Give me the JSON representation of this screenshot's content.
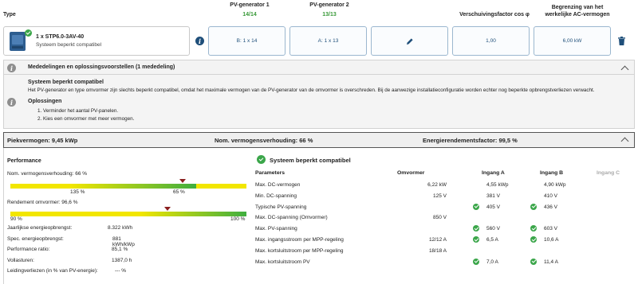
{
  "header": {
    "type_label": "Type",
    "pv1_label": "PV-generator 1",
    "pv1_count": "14/14",
    "pv2_label": "PV-generator 2",
    "pv2_count": "13/13",
    "cos_label": "Verschuivingsfactor cos φ",
    "limit_label_1": "Begrenzing van het",
    "limit_label_2": "werkelijke AC-vermogen"
  },
  "inverter": {
    "name": "1 x STP6.0-3AV-40",
    "status": "Systeem beperkt compatibel",
    "pv1_value": "B: 1 x 14",
    "pv2_value": "A: 1 x 13",
    "cos_value": "1,00",
    "limit_value": "6,00 kW"
  },
  "notices": {
    "header": "Mededelingen en oplossingsvoorstellen (1 mededeling)",
    "title": "Systeem beperkt compatibel",
    "text": "Het PV-generator en type omvormer zijn slechts beperkt compatibel, omdat het maximale vermogen van de PV-generator van de omvormer is overschreden. Bij de aanwezige installatieconfiguratie worden echter nog beperkte opbrengstverliezen verwacht.",
    "solutions_title": "Oplossingen",
    "solutions": [
      "1. Verminder het aantal PV-panelen.",
      "2. Kies een omvormer met meer vermogen."
    ]
  },
  "summary": {
    "peak": "Piekvermogen: 9,45 kWp",
    "ratio": "Nom. vermogensverhouding: 66 %",
    "efficiency": "Energierendementsfactor: 99,5 %"
  },
  "performance": {
    "title": "Performance",
    "ratio_label": "Nom. vermogensverhouding: 66 %",
    "ratio_value": 0.66,
    "ratio_tick_left": "135 %",
    "ratio_tick_right": "65 %",
    "eff_label": "Rendement omvormer: 96,6 %",
    "eff_value": 0.966,
    "eff_tick_left": "90 %",
    "eff_tick_right": "100 %",
    "stats": [
      {
        "label": "Jaarlijkse energieopbrengst:",
        "value": "8.322 kWh"
      },
      {
        "label": "Spec. energieopbrengst:",
        "value": "881 kWh/kWp"
      },
      {
        "label": "Performance ratio:",
        "value": "85,1 %"
      },
      {
        "label": "Vollasturen:",
        "value": "1387,0 h"
      },
      {
        "label": "Leidingverliezen (in % van PV-energie):",
        "value": "--- %"
      }
    ]
  },
  "compat": {
    "title": "Systeem beperkt compatibel",
    "columns": [
      "Parameters",
      "Omvormer",
      "Ingang A",
      "Ingang B",
      "Ingang C"
    ],
    "rows": [
      {
        "param": "Max. DC-vermogen",
        "inv": "6,22 kW",
        "a": "4,55 kWp",
        "b": "4,90 kWp",
        "ca": false,
        "cb": false
      },
      {
        "param": "Min. DC-spanning",
        "inv": "125 V",
        "a": "381 V",
        "b": "410 V",
        "ca": false,
        "cb": false
      },
      {
        "param": "Typische PV-spanning",
        "inv": "",
        "a": "405 V",
        "b": "436 V",
        "ca": true,
        "cb": true
      },
      {
        "param": "Max. DC-spanning (Omvormer)",
        "inv": "850 V",
        "a": "",
        "b": "",
        "ca": false,
        "cb": false
      },
      {
        "param": "Max. PV-spanning",
        "inv": "",
        "a": "560 V",
        "b": "603 V",
        "ca": true,
        "cb": true
      },
      {
        "param": "Max. ingangsstroom per MPP-regeling",
        "inv": "12/12 A",
        "a": "6,5 A",
        "b": "10,6 A",
        "ca": true,
        "cb": true
      },
      {
        "param": "Max. kortsluitstroom per MPP-regeling",
        "inv": "18/18 A",
        "a": "",
        "b": "",
        "ca": false,
        "cb": false
      },
      {
        "param": "Max. kortsluitstroom PV",
        "inv": "",
        "a": "7,0 A",
        "b": "11,4 A",
        "ca": true,
        "cb": true
      }
    ]
  },
  "colors": {
    "accent": "#1f4f7a",
    "ok": "#3ba64a",
    "bar_yellow": "#f2e600",
    "bar_green": "#3fae3f",
    "marker": "#8a1e1e"
  }
}
